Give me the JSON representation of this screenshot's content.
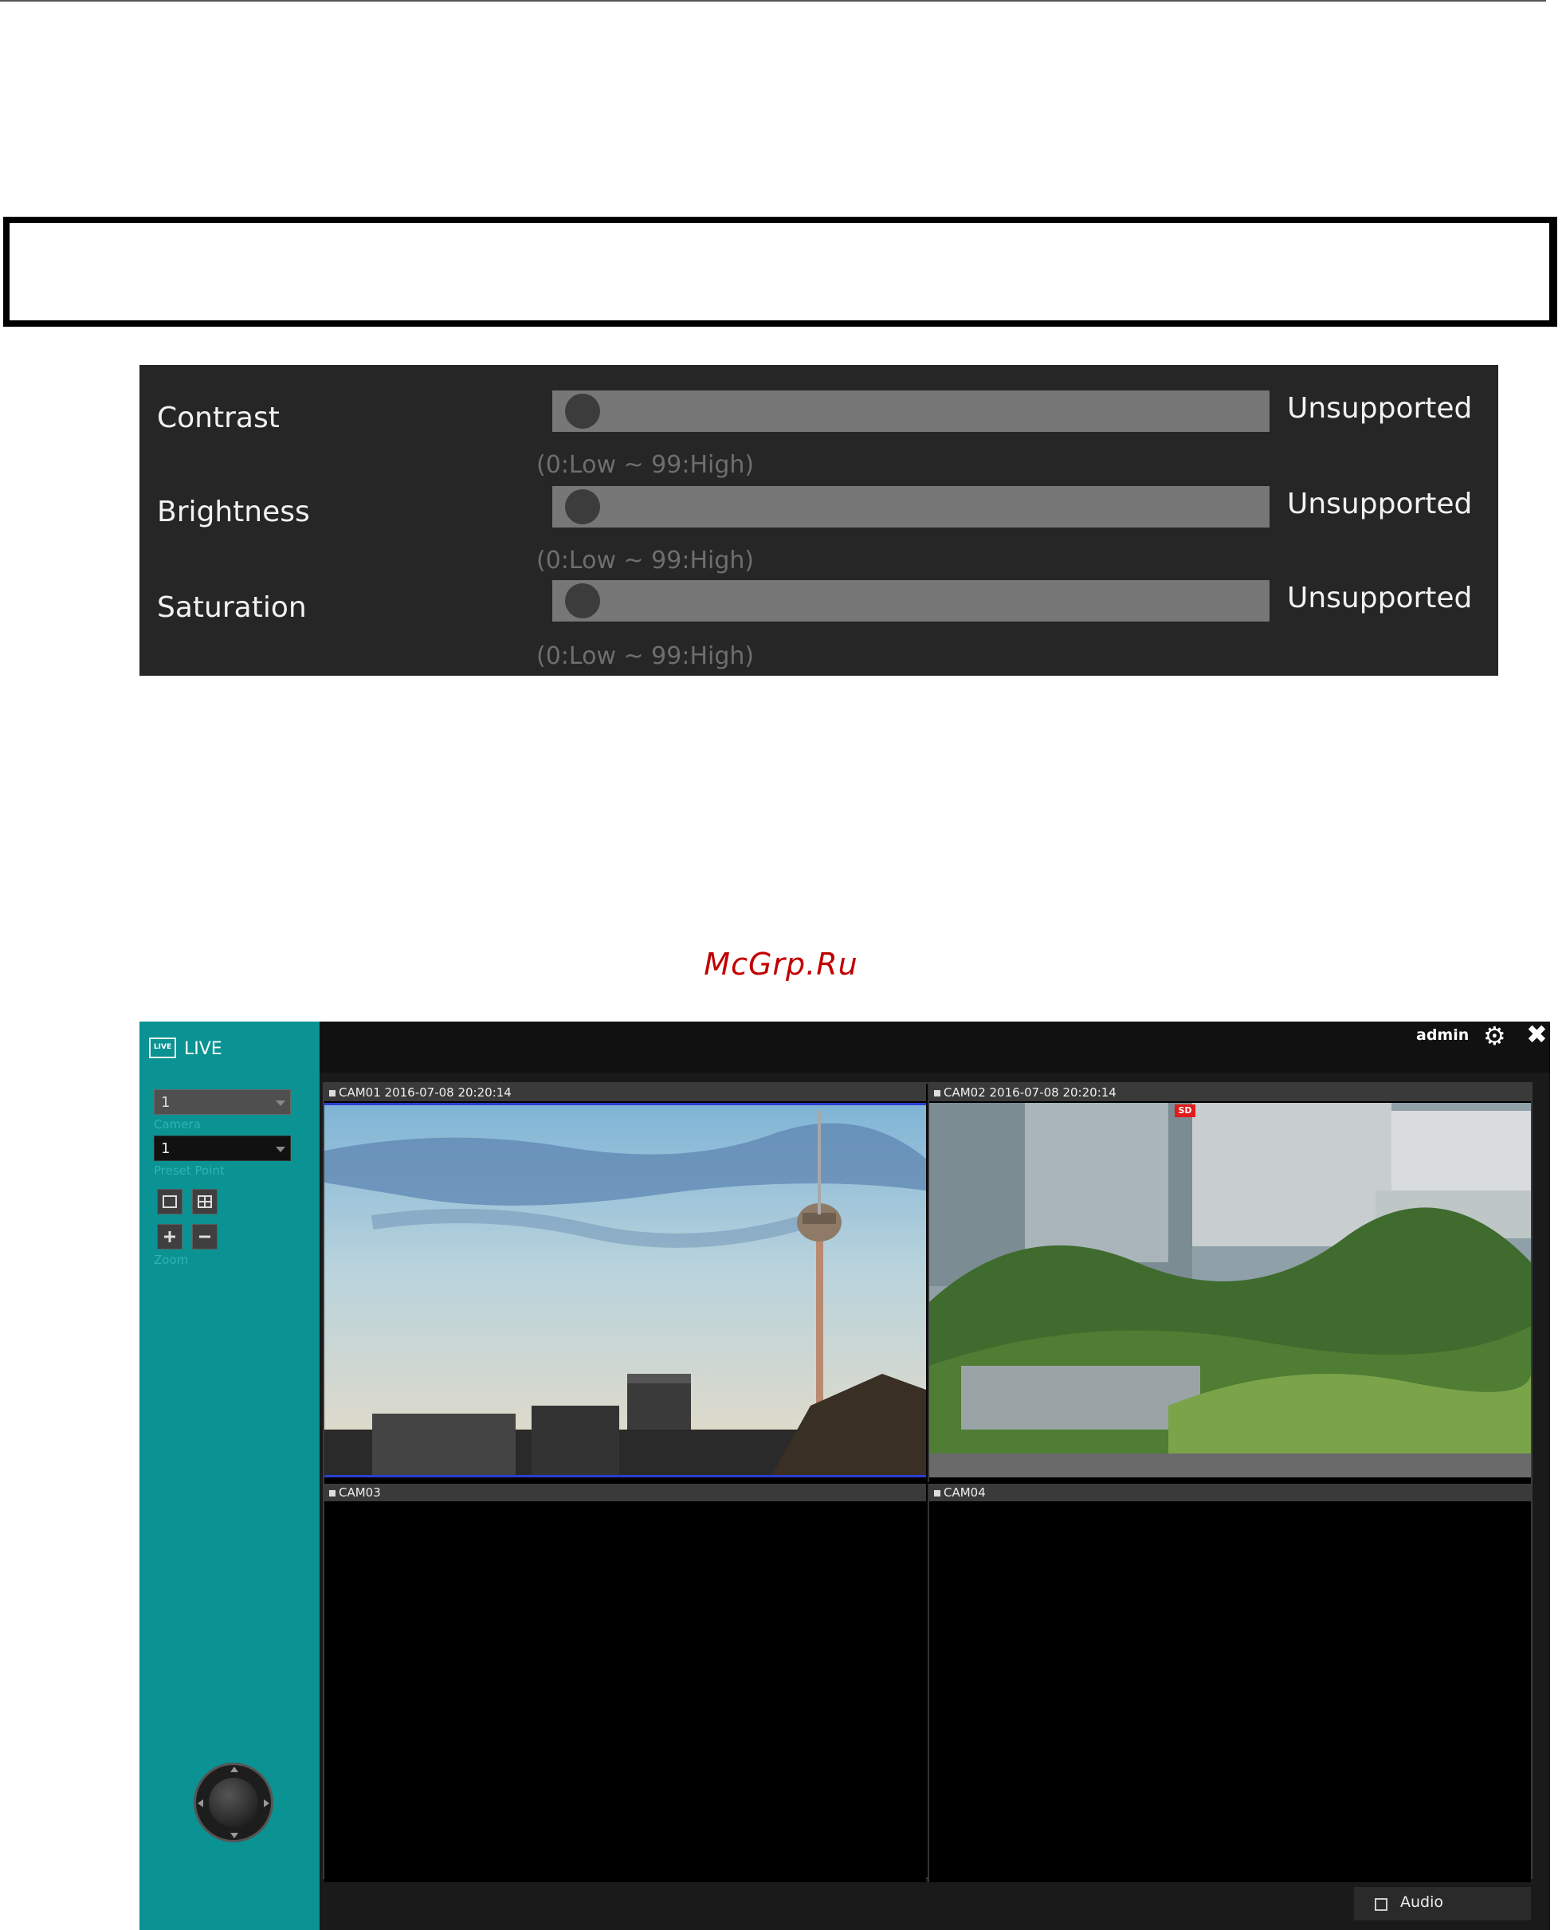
{
  "image_adjust": {
    "rows": [
      {
        "label": "Contrast",
        "status": "Unsupported",
        "range_hint": "(0:Low ~ 99:High)",
        "value": 0
      },
      {
        "label": "Brightness",
        "status": "Unsupported",
        "range_hint": "(0:Low ~ 99:High)",
        "value": 0
      },
      {
        "label": "Saturation",
        "status": "Unsupported",
        "range_hint": "(0:Low ~ 99:High)",
        "value": 0
      }
    ]
  },
  "watermark": "McGrp.Ru",
  "live_app": {
    "mode_label": "LIVE",
    "mode_icon_text": "LIVE",
    "user": "admin",
    "ptz": {
      "camera_value": "1",
      "camera_label": "Camera",
      "preset_value": "1",
      "preset_label": "Preset Point",
      "zoom_label": "Zoom"
    },
    "cameras": [
      {
        "title": "CAM01 2016-07-08 20:20:14"
      },
      {
        "title": "CAM02 2016-07-08 20:20:14",
        "badge": "SD"
      },
      {
        "title": "CAM03"
      },
      {
        "title": "CAM04"
      }
    ],
    "audio_label": "Audio",
    "colors": {
      "sidebar": "#0b9293",
      "selection": "#2a3fd1"
    }
  }
}
